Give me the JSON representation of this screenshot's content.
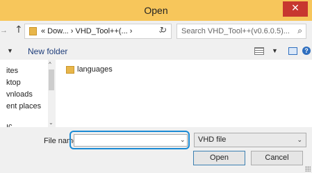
{
  "window": {
    "title": "Open",
    "close_glyph": "✕"
  },
  "address": {
    "back_glyph": "→",
    "up_glyph": "↑",
    "breadcrumb": "« Dow... › VHD_Tool++(... ›",
    "dropdown_glyph": "⌄",
    "refresh_glyph": "↻",
    "search_placeholder": "Search VHD_Tool++(v0.6.0.5)...",
    "search_glyph": "⌕"
  },
  "toolbar": {
    "organize_glyph": "▼",
    "new_folder_label": "New folder",
    "view_drop_glyph": "▼",
    "help_glyph": "?"
  },
  "nav_pane": {
    "items": [
      "ites",
      "ktop",
      "vnloads",
      "ent places",
      "ıc"
    ],
    "scroll_up": "^",
    "scroll_down": "⌄"
  },
  "files": [
    {
      "name": "languages",
      "icon": "folder-icon"
    }
  ],
  "footer": {
    "file_name_label": "File name:",
    "file_name_value": "",
    "file_name_drop": "⌄",
    "file_type_value": "VHD file",
    "file_type_drop": "⌄",
    "open_label": "Open",
    "cancel_label": "Cancel"
  },
  "colors": {
    "title_bar": "#f7c65b",
    "close_button": "#c7372f",
    "focus_ring": "#1a8ad4"
  }
}
